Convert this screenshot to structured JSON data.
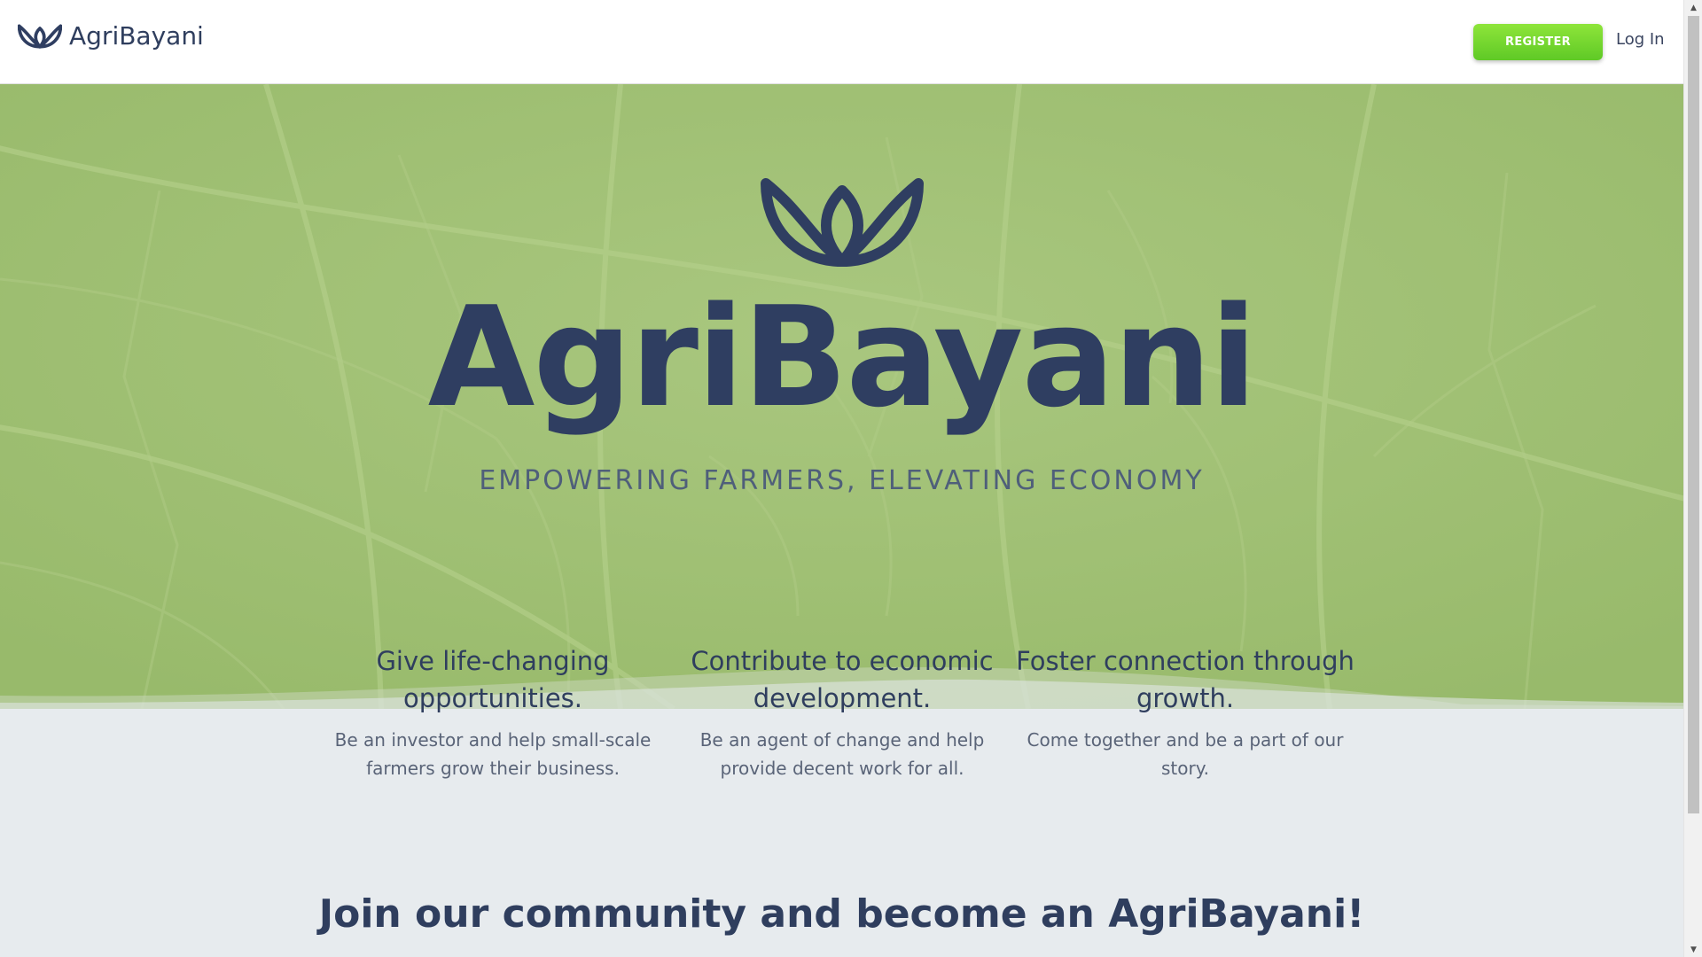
{
  "navbar": {
    "brand_name": "AgriBayani",
    "register_label": "REGISTER",
    "login_label": "Log In"
  },
  "hero": {
    "title": "AgriBayani",
    "tagline": "EMPOWERING FARMERS, ELEVATING ECONOMY"
  },
  "features": [
    {
      "title": "Give life-changing opportunities.",
      "description": "Be an investor and help small-scale farmers grow their business."
    },
    {
      "title": "Contribute to economic development.",
      "description": "Be an agent of change and help provide decent work for all."
    },
    {
      "title": "Foster connection through growth.",
      "description": "Come together and be a part of our story."
    }
  ],
  "join": {
    "heading": "Join our community and become an AgriBayani!"
  },
  "colors": {
    "brand_navy": "#2f3e61",
    "register_green": "#6fd42e",
    "hero_green": "#a4c478",
    "page_bg": "#e7ebee"
  },
  "icons": {
    "brand_logo": "leaf-lotus-icon",
    "scroll_up": "scroll-up-arrow-icon",
    "scroll_down": "scroll-down-arrow-icon"
  }
}
